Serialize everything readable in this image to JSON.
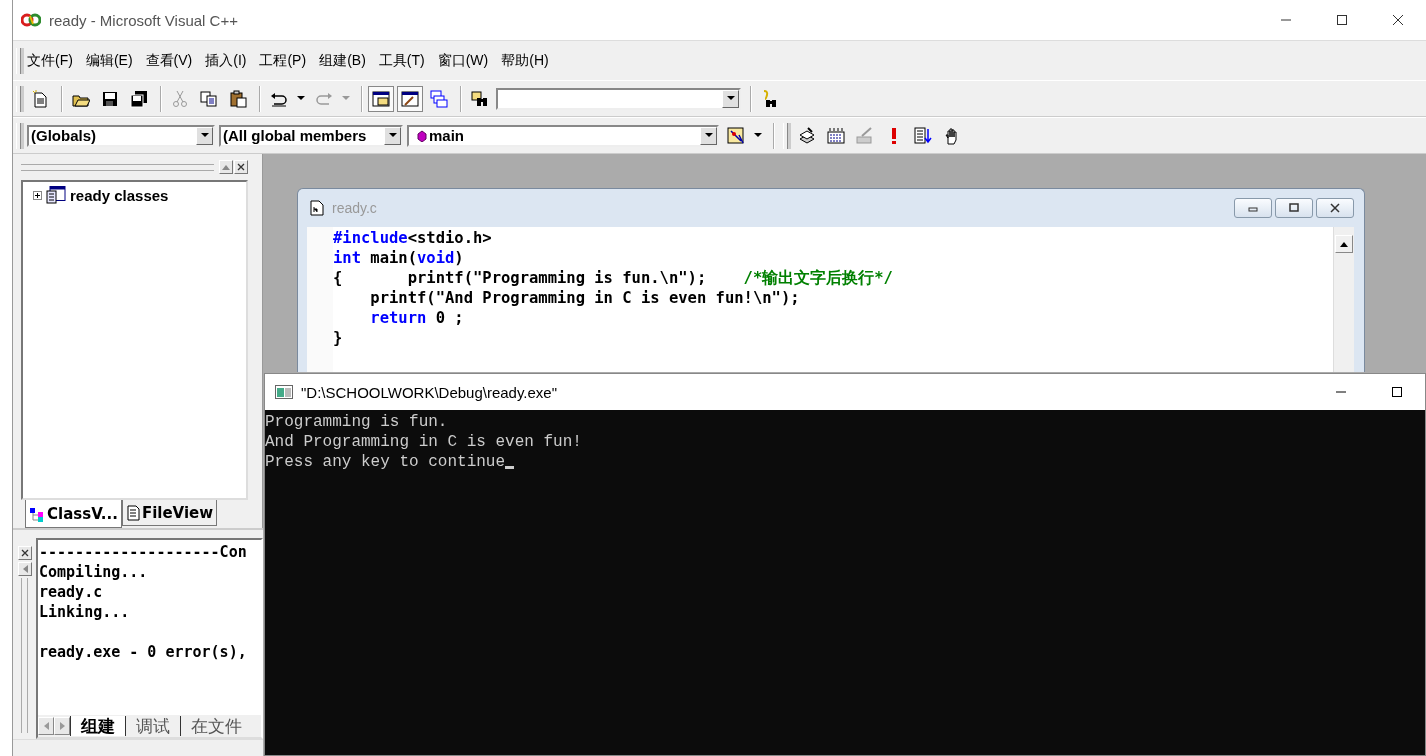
{
  "window": {
    "title": "ready - Microsoft Visual C++"
  },
  "menu": [
    {
      "label": "文件(F)"
    },
    {
      "label": "编辑(E)"
    },
    {
      "label": "查看(V)"
    },
    {
      "label": "插入(I)"
    },
    {
      "label": "工程(P)"
    },
    {
      "label": "组建(B)"
    },
    {
      "label": "工具(T)"
    },
    {
      "label": "窗口(W)"
    },
    {
      "label": "帮助(H)"
    }
  ],
  "wizard_bar": {
    "class_combo": "(Globals)",
    "members_combo": "(All global members",
    "function_combo": "main"
  },
  "workspace": {
    "tree": [
      {
        "label": "ready classes",
        "expanded": false
      }
    ],
    "tabs": [
      {
        "label": "ClassV...",
        "selected": true
      },
      {
        "label": "FileView",
        "selected": false
      }
    ]
  },
  "editor": {
    "title": "ready.c",
    "lines": [
      [
        {
          "kind": "keyword",
          "text": "#include"
        },
        {
          "kind": "plain",
          "text": "<stdio.h>"
        }
      ],
      [
        {
          "kind": "keyword",
          "text": "int"
        },
        {
          "kind": "plain",
          "text": " main("
        },
        {
          "kind": "keyword",
          "text": "void"
        },
        {
          "kind": "plain",
          "text": ")"
        }
      ],
      [
        {
          "kind": "plain",
          "text": "{       printf(\"Programming is fun.\\n\");    "
        },
        {
          "kind": "comment",
          "text": "/*输出文字后换行*/"
        }
      ],
      [
        {
          "kind": "plain",
          "text": "    printf(\"And Programming in C is even fun!\\n\");"
        }
      ],
      [
        {
          "kind": "keyword",
          "text": "    return"
        },
        {
          "kind": "plain",
          "text": " 0 ;"
        }
      ],
      [
        {
          "kind": "plain",
          "text": "}"
        }
      ]
    ]
  },
  "output": {
    "lines": [
      "--------------------Con",
      "Compiling...",
      "ready.c",
      "Linking..."
    ],
    "summary": "ready.exe - 0 error(s),",
    "tabs": [
      {
        "label": "组建",
        "selected": true
      },
      {
        "label": "调试",
        "selected": false
      },
      {
        "label": "在文件",
        "selected": false
      }
    ]
  },
  "console": {
    "title": "\"D:\\SCHOOLWORK\\Debug\\ready.exe\"",
    "lines": [
      "Programming is fun.",
      "And Programming in C is even fun!",
      "Press any key to continue"
    ],
    "cursor": true
  }
}
